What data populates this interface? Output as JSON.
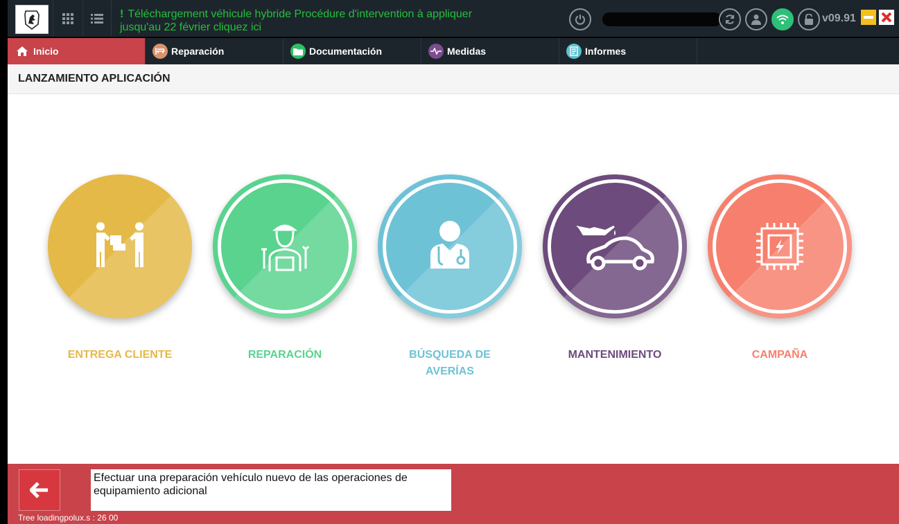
{
  "topbar": {
    "notice_mark": "!",
    "notice_text": "Téléchargement véhicule hybride Procédure d'intervention à appliquer jusqu'au 22 février cliquez ici",
    "version": "v09.91",
    "icons": [
      "peugeot-logo",
      "grid-icon",
      "list-icon",
      "power-icon",
      "refresh-icon",
      "user-icon",
      "wifi-icon",
      "unlock-icon",
      "minimize-icon",
      "close-icon"
    ]
  },
  "nav": {
    "items": [
      {
        "label": "Inicio",
        "active": true,
        "color": "#c8434a"
      },
      {
        "label": "Reparación",
        "color": "#d9926c"
      },
      {
        "label": "Documentación",
        "color": "#2fbf63"
      },
      {
        "label": "Medidas",
        "color": "#7b4c8f"
      },
      {
        "label": "Informes",
        "color": "#5cc1cf"
      }
    ]
  },
  "section": {
    "title": "LANZAMIENTO APLICACIÓN"
  },
  "tiles": [
    {
      "label": "ENTREGA CLIENTE",
      "color": "#e5b947",
      "icon": "handover-icon"
    },
    {
      "label": "REPARACIÓN",
      "color": "#59d38e",
      "icon": "mechanic-icon"
    },
    {
      "label": "BÚSQUEDA DE AVERÍAS",
      "color": "#6ec2d6",
      "icon": "doctor-icon"
    },
    {
      "label": "MANTENIMIENTO",
      "color": "#6d4b7c",
      "icon": "oil-car-icon"
    },
    {
      "label": "CAMPAÑA",
      "color": "#f77f6d",
      "icon": "chip-icon"
    }
  ],
  "footer": {
    "description": "Efectuar una preparación vehículo nuevo de las operaciones de equipamiento adicional",
    "status": "Tree  loadingpolux.s : 26  00"
  }
}
